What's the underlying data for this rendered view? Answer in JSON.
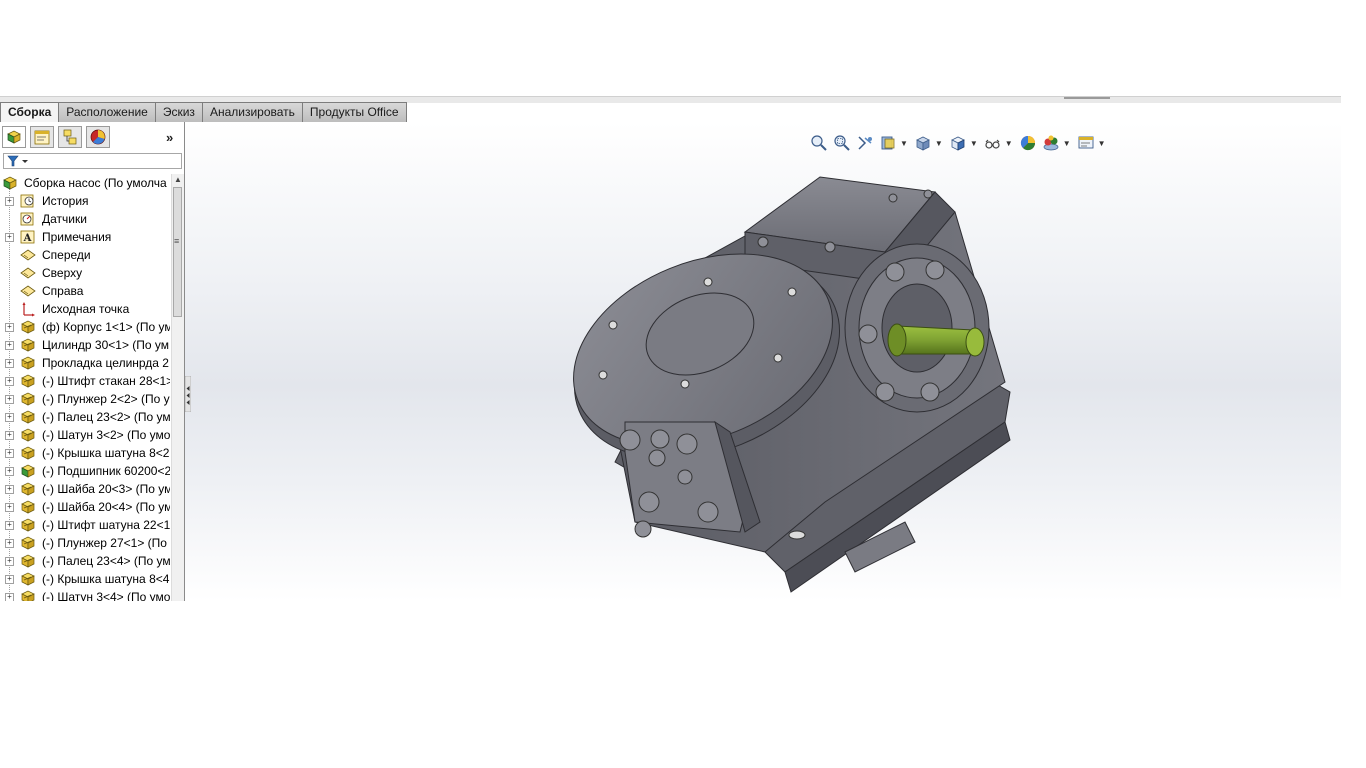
{
  "tabs": [
    {
      "label": "Сборка",
      "active": true
    },
    {
      "label": "Расположение",
      "active": false
    },
    {
      "label": "Эскиз",
      "active": false
    },
    {
      "label": "Анализировать",
      "active": false
    },
    {
      "label": "Продукты Office",
      "active": false
    }
  ],
  "panel": {
    "more_label": "»",
    "tabs": [
      "feature-manager-icon",
      "property-manager-icon",
      "configuration-manager-icon",
      "appearance-manager-icon"
    ]
  },
  "tree": {
    "root": {
      "label": "Сборка насос  (По умолча",
      "icon": "assembly-icon"
    },
    "items": [
      {
        "label": "История",
        "icon": "history-icon",
        "expandable": true
      },
      {
        "label": "Датчики",
        "icon": "sensor-icon",
        "expandable": false
      },
      {
        "label": "Примечания",
        "icon": "annotation-icon",
        "expandable": true
      },
      {
        "label": "Спереди",
        "icon": "plane-icon",
        "expandable": false
      },
      {
        "label": "Сверху",
        "icon": "plane-icon",
        "expandable": false
      },
      {
        "label": "Справа",
        "icon": "plane-icon",
        "expandable": false
      },
      {
        "label": "Исходная точка",
        "icon": "origin-icon",
        "expandable": false
      },
      {
        "label": "(ф) Корпус 1<1> (По ум",
        "icon": "part-icon",
        "expandable": true
      },
      {
        "label": "Цилиндр 30<1> (По ум",
        "icon": "part-icon",
        "expandable": true
      },
      {
        "label": "Прокладка целинрда 2",
        "icon": "part-icon",
        "expandable": true
      },
      {
        "label": "(-) Штифт стакан 28<1>",
        "icon": "part-icon",
        "expandable": true
      },
      {
        "label": "(-) Плунжер 2<2> (По у",
        "icon": "part-icon",
        "expandable": true
      },
      {
        "label": "(-) Палец 23<2> (По ум",
        "icon": "part-icon",
        "expandable": true
      },
      {
        "label": "(-) Шатун 3<2> (По умо",
        "icon": "part-icon",
        "expandable": true
      },
      {
        "label": "(-) Крышка шатуна 8<2",
        "icon": "part-icon",
        "expandable": true
      },
      {
        "label": "(-) Подшипник 60200<2",
        "icon": "part-green-icon",
        "expandable": true
      },
      {
        "label": "(-) Шайба 20<3> (По ум",
        "icon": "part-icon",
        "expandable": true
      },
      {
        "label": "(-) Шайба 20<4> (По ум",
        "icon": "part-icon",
        "expandable": true
      },
      {
        "label": "(-) Штифт шатуна 22<1",
        "icon": "part-icon",
        "expandable": true
      },
      {
        "label": "(-) Плунжер 27<1> (По",
        "icon": "part-icon",
        "expandable": true
      },
      {
        "label": "(-) Палец 23<4> (По ум",
        "icon": "part-icon",
        "expandable": true
      },
      {
        "label": "(-) Крышка шатуна 8<4",
        "icon": "part-icon",
        "expandable": true
      },
      {
        "label": "(-) Шатун 3<4> (По умо",
        "icon": "part-icon",
        "expandable": true
      }
    ]
  },
  "hud": {
    "buttons": [
      "zoom-to-fit-icon",
      "zoom-to-area-icon",
      "previous-view-icon",
      "section-view-icon",
      "view-orientation-icon",
      "display-style-icon",
      "hide-show-items-icon",
      "edit-appearance-icon",
      "apply-scene-icon",
      "view-settings-icon"
    ]
  },
  "window_controls": [
    "restore-tile-icon",
    "restore-tile-2-icon",
    "minimize-icon",
    "restore-icon"
  ],
  "colors": {
    "model_body": "#6e6f77",
    "model_shaft": "#7fa233",
    "tab_active": "#f4f4f4"
  }
}
